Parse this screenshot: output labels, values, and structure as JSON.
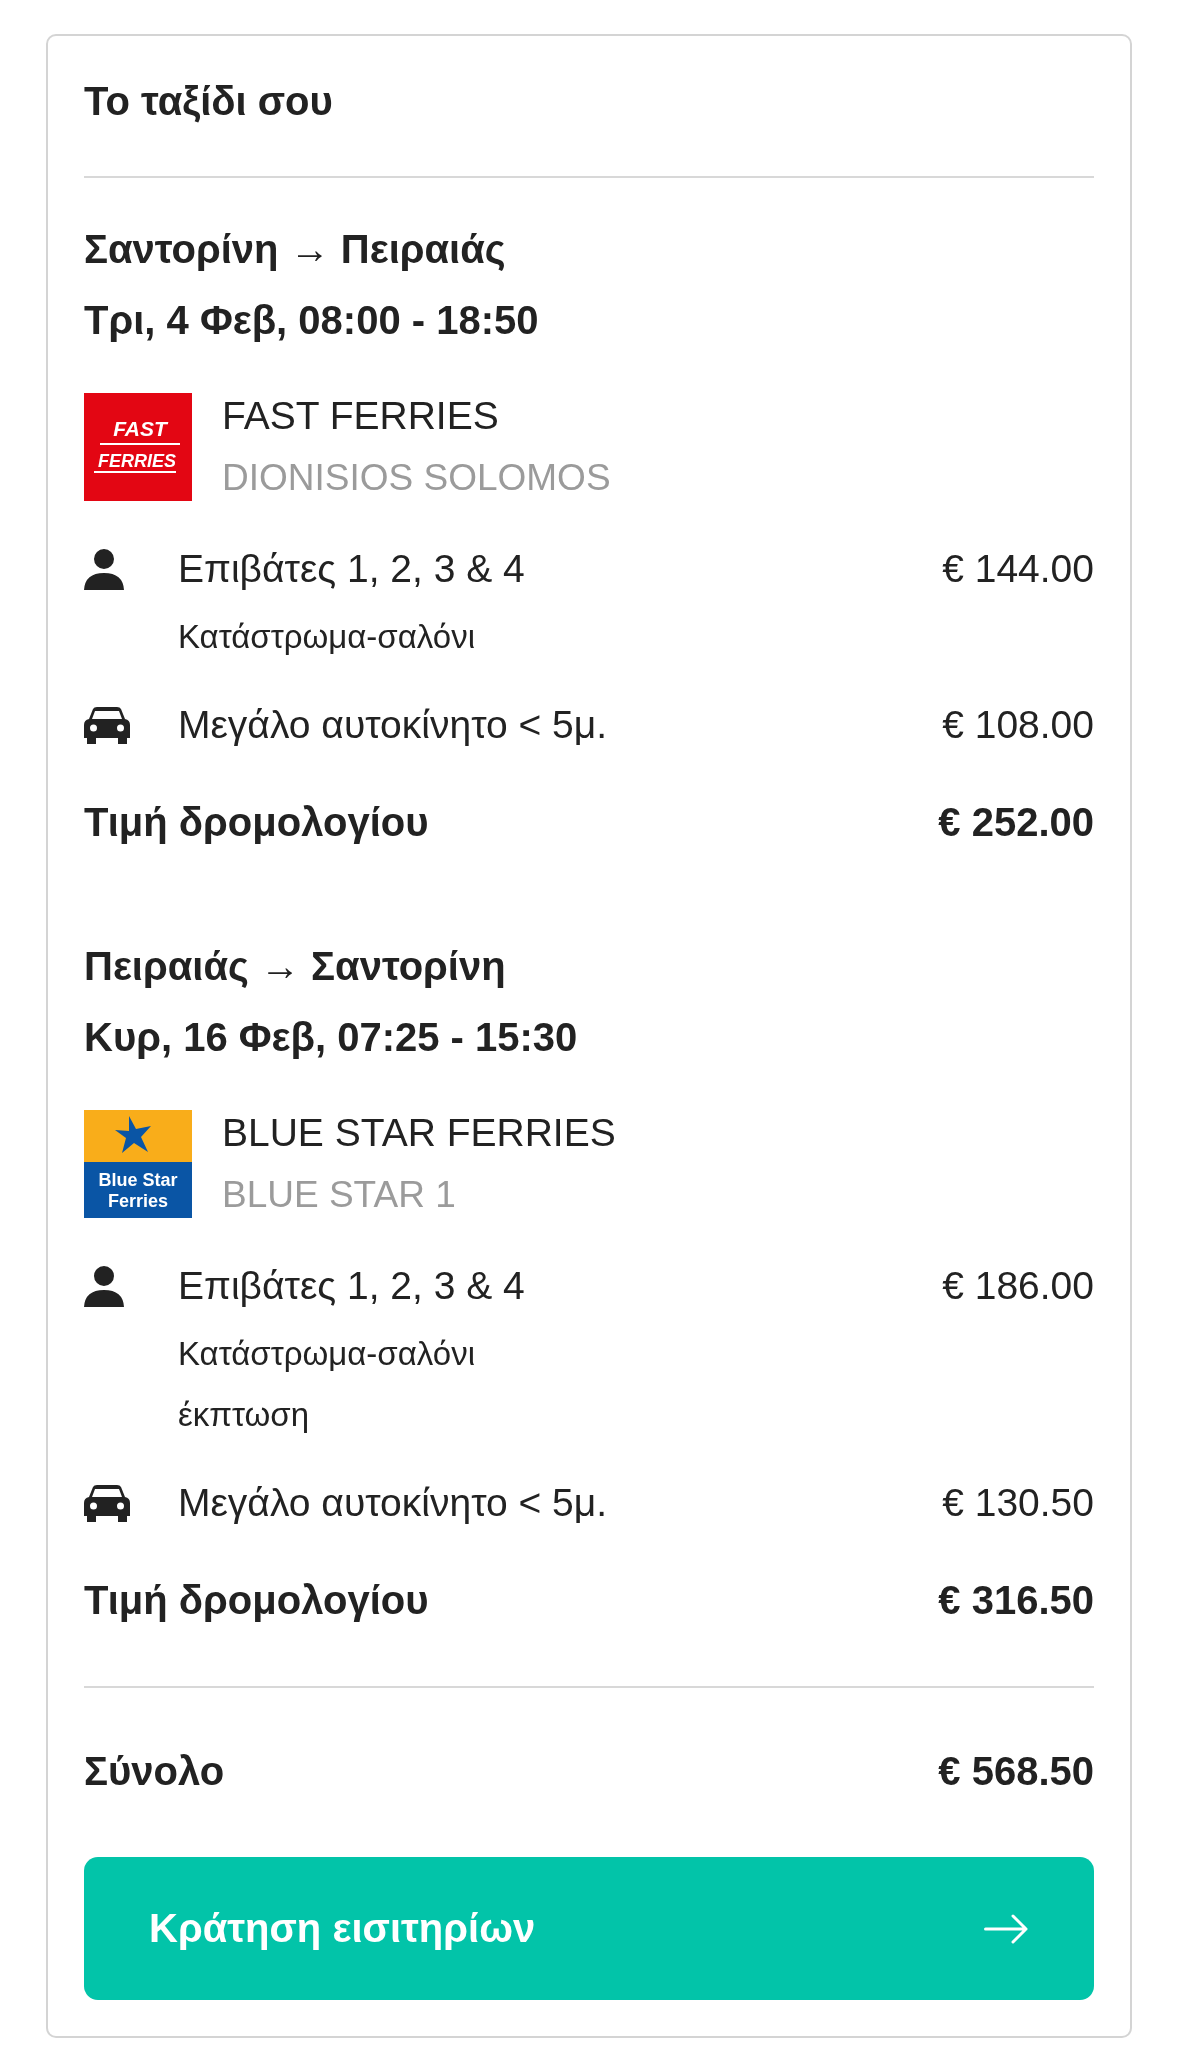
{
  "title": "Το ταξίδι σου",
  "legs": [
    {
      "route": "Σαντορίνη → Πειραιάς",
      "schedule": "Τρι, 4 Φεβ, 08:00 - 18:50",
      "operator": {
        "name": "FAST FERRIES",
        "vessel": "DIONISIOS SOLOMOS",
        "logo": {
          "kind": "fast",
          "lines": [
            "FAST",
            "FERRIES"
          ]
        }
      },
      "items": [
        {
          "kind": "passenger",
          "label": "Επιβάτες 1, 2, 3 & 4",
          "notes": [
            "Κατάστρωμα-σαλόνι"
          ],
          "price": "€ 144.00"
        },
        {
          "kind": "car",
          "label": "Μεγάλο αυτοκίνητο < 5μ.",
          "price": "€ 108.00"
        }
      ],
      "subtotal": {
        "label": "Τιμή δρομολογίου",
        "price": "€ 252.00"
      }
    },
    {
      "route": "Πειραιάς → Σαντορίνη",
      "schedule": "Κυρ, 16 Φεβ, 07:25 - 15:30",
      "operator": {
        "name": "BLUE STAR FERRIES",
        "vessel": "BLUE STAR 1",
        "logo": {
          "kind": "star",
          "lines": [
            "Blue Star",
            "Ferries"
          ]
        }
      },
      "items": [
        {
          "kind": "passenger",
          "label": "Επιβάτες 1, 2, 3 & 4",
          "notes": [
            "Κατάστρωμα-σαλόνι",
            "έκπτωση"
          ],
          "price": "€ 186.00"
        },
        {
          "kind": "car",
          "label": "Μεγάλο αυτοκίνητο < 5μ.",
          "price": "€ 130.50"
        }
      ],
      "subtotal": {
        "label": "Τιμή δρομολογίου",
        "price": "€ 316.50"
      }
    }
  ],
  "total": {
    "label": "Σύνολο",
    "price": "€ 568.50"
  },
  "book_button": {
    "label": "Κράτηση εισιτηρίων"
  }
}
